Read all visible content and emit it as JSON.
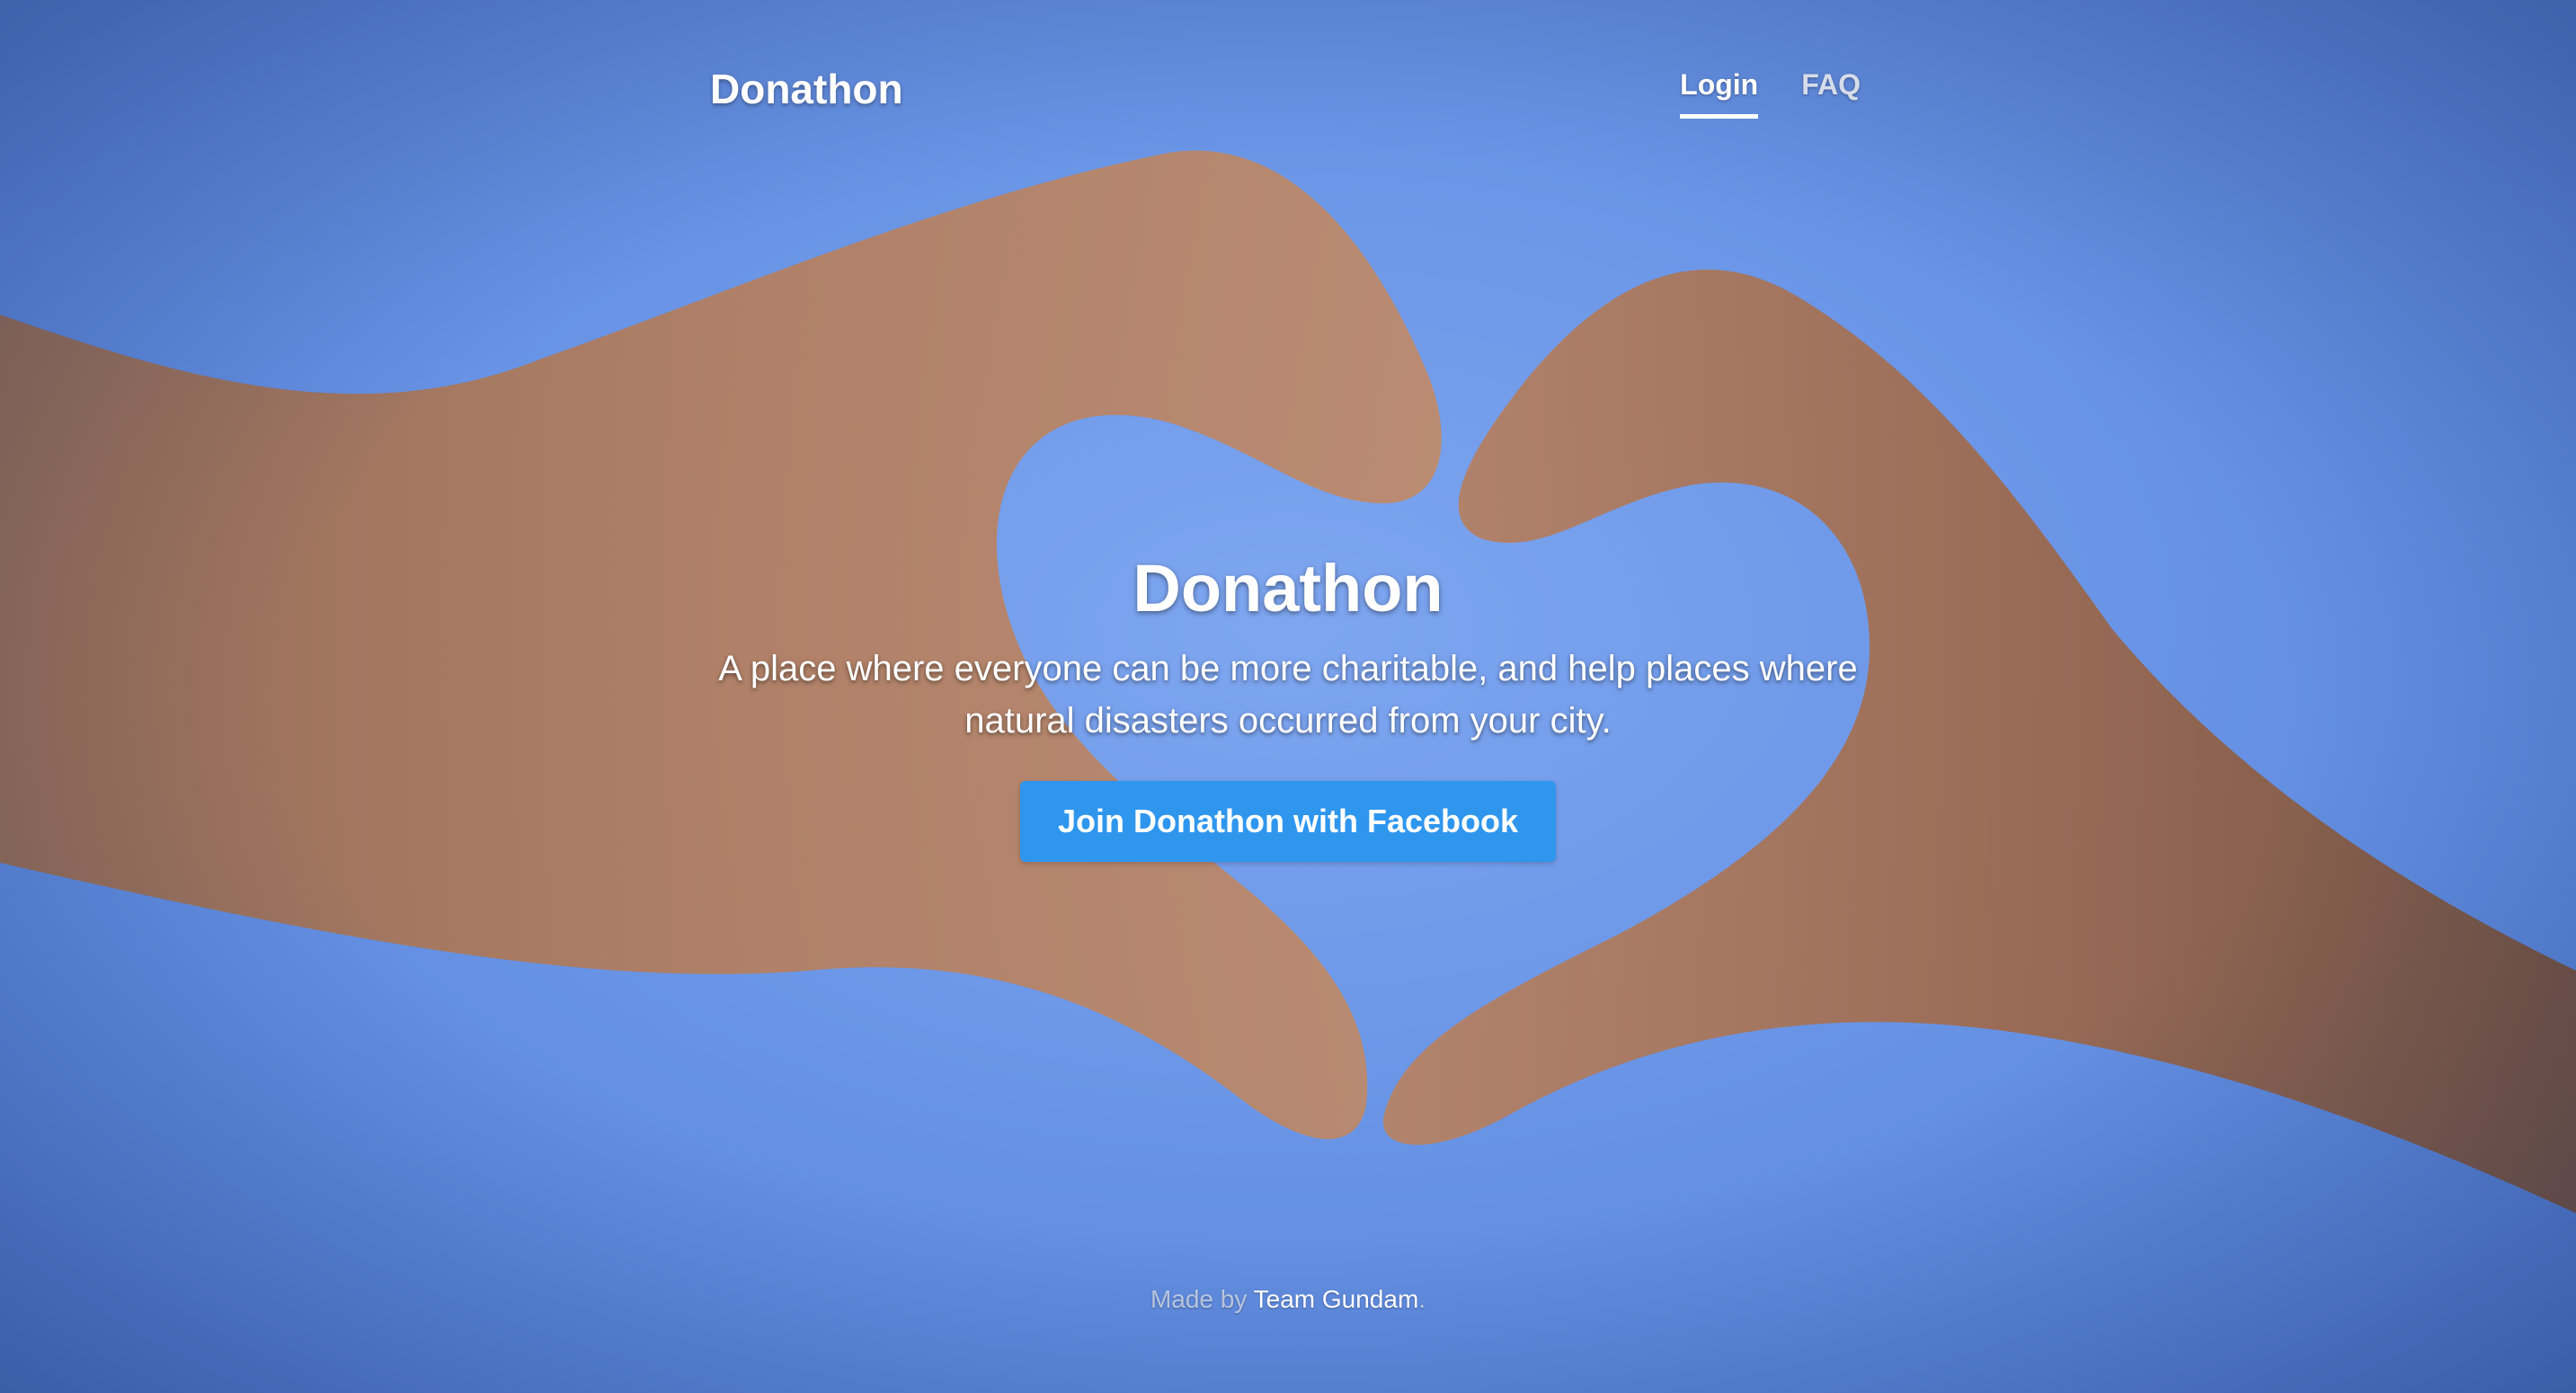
{
  "masthead": {
    "brand": "Donathon",
    "nav": [
      {
        "label": "Login",
        "active": true
      },
      {
        "label": "FAQ",
        "active": false
      }
    ]
  },
  "cover": {
    "heading": "Donathon",
    "lead": "A place where everyone can be more charitable, and help places where natural disasters occurred from your city.",
    "button_label": "Join Donathon with Facebook"
  },
  "footer": {
    "prefix": "Made by ",
    "team": "Team Gundam",
    "suffix": "."
  },
  "colors": {
    "sky": "#6a95e6",
    "button": "#2f96ee",
    "text": "#ffffff"
  }
}
